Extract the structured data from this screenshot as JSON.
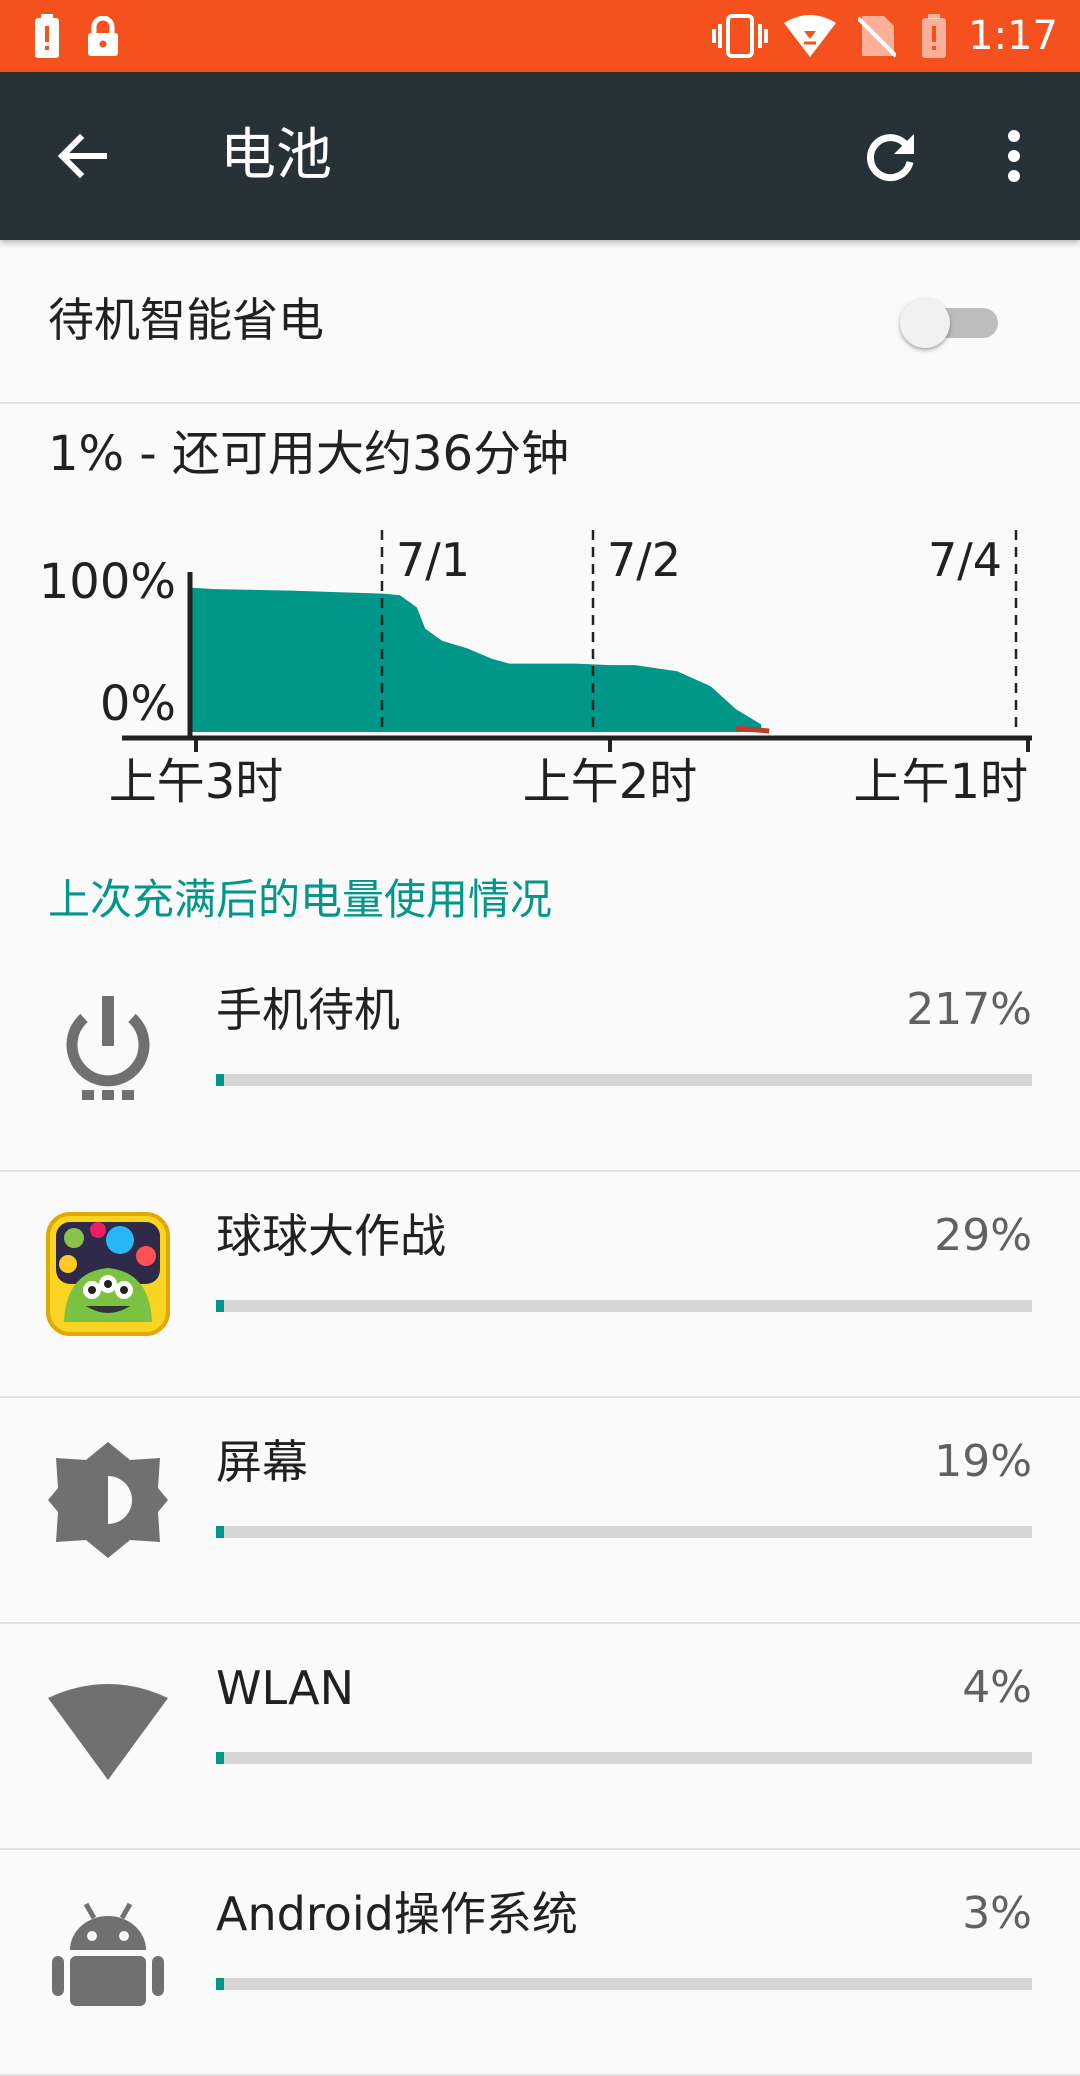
{
  "status_bar": {
    "time": "1:17",
    "background": "#f4511e",
    "icons": [
      "battery-alert-icon",
      "lock-icon",
      "vibrate-icon",
      "wifi-icon",
      "no-sim-icon",
      "battery-low-icon"
    ]
  },
  "app_bar": {
    "title": "电池",
    "background": "#263238",
    "back_icon": "arrow-back-icon",
    "refresh_icon": "refresh-icon",
    "more_icon": "more-vert-icon"
  },
  "smart_standby": {
    "label": "待机智能省电",
    "enabled": false
  },
  "battery_summary": {
    "text": "1% - 还可用大约36分钟"
  },
  "chart_data": {
    "type": "area",
    "y_tick_labels": [
      "100%",
      "0%"
    ],
    "ylim": [
      0,
      100
    ],
    "date_markers": [
      "7/1",
      "7/2",
      "7/4"
    ],
    "x_tick_labels": [
      "上午3时",
      "上午2时",
      "上午1时"
    ],
    "series": [
      {
        "color": "#009688",
        "x": [
          0,
          0.03,
          0.12,
          0.23,
          0.25,
          0.27,
          0.28,
          0.3,
          0.33,
          0.36,
          0.38,
          0.46,
          0.5,
          0.53,
          0.58,
          0.62,
          0.65,
          0.68
        ],
        "y": [
          95,
          94,
          93,
          91,
          90,
          82,
          68,
          60,
          55,
          48,
          45,
          45,
          44,
          44,
          40,
          30,
          15,
          5
        ]
      }
    ],
    "grid": false
  },
  "usage": {
    "section_title": "上次充满后的电量使用情况",
    "accent": "#00968a",
    "items": [
      {
        "name": "手机待机",
        "percent_label": "217%",
        "icon": "power-standby-icon",
        "fill": 0.01
      },
      {
        "name": "球球大作战",
        "percent_label": "29%",
        "icon": "game-app-icon",
        "fill": 0.01
      },
      {
        "name": "屏幕",
        "percent_label": "19%",
        "icon": "brightness-icon",
        "fill": 0.01
      },
      {
        "name": "WLAN",
        "percent_label": "4%",
        "icon": "wifi-icon",
        "fill": 0.01
      },
      {
        "name": "Android操作系统",
        "percent_label": "3%",
        "icon": "android-icon",
        "fill": 0.01
      }
    ]
  }
}
